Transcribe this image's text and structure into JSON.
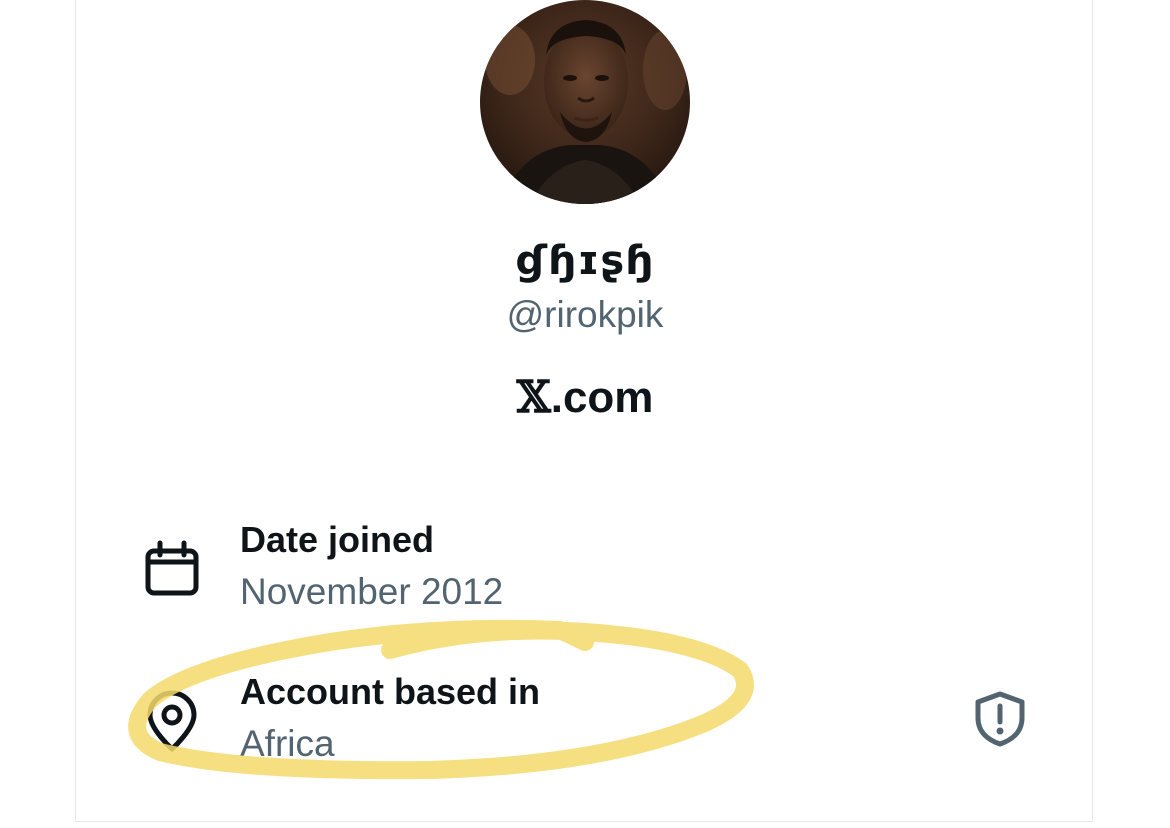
{
  "profile": {
    "display_name": "ɠɧɪʂɧ",
    "handle": "@rirokpik",
    "site_prefix": "𝕏",
    "site_suffix": ".com",
    "avatar_icon": "profile-photo"
  },
  "about": {
    "date_joined": {
      "icon": "calendar-icon",
      "title": "Date joined",
      "value": "November 2012"
    },
    "account_based_in": {
      "icon": "location-pin-icon",
      "title": "Account based in",
      "value": "Africa",
      "action_icon": "shield-alert-icon"
    }
  },
  "colors": {
    "primary_text": "#0f1419",
    "secondary_text": "#536471",
    "highlight": "#f5d96a"
  }
}
